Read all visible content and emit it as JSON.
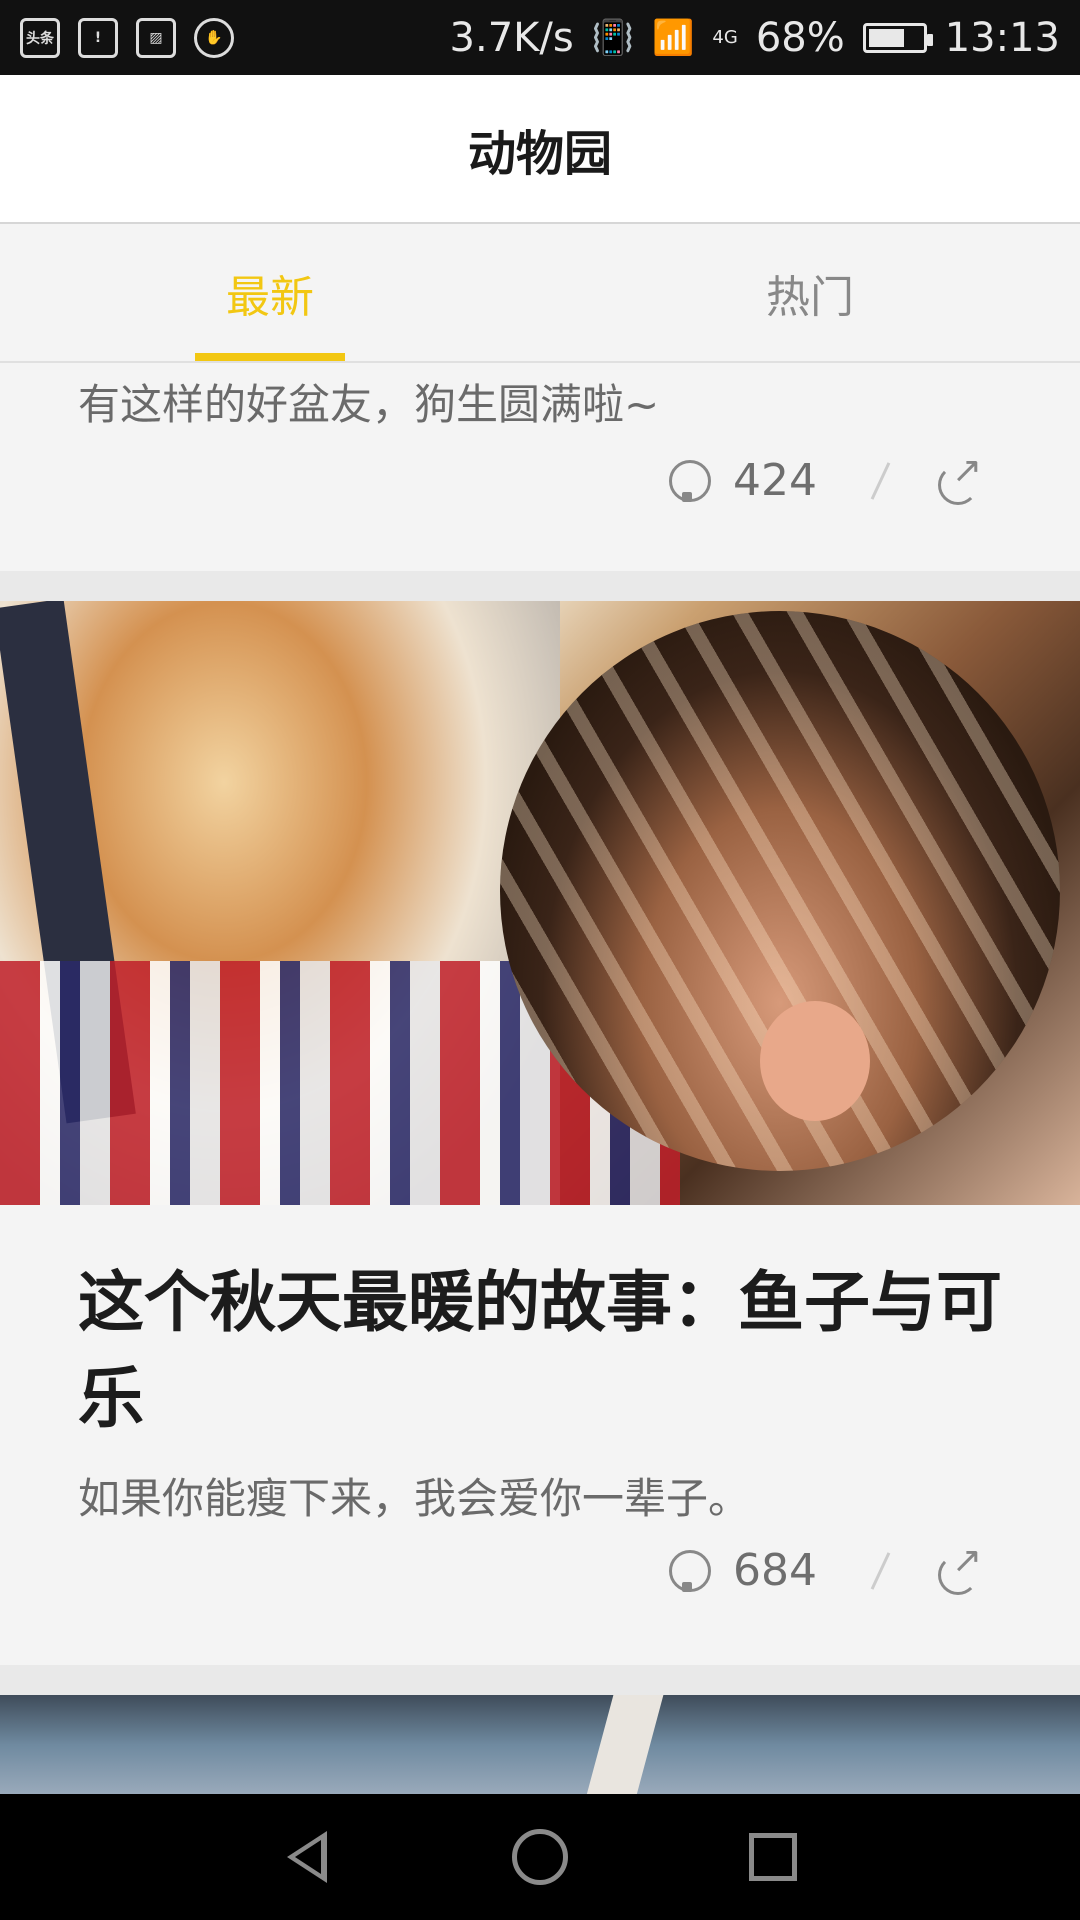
{
  "status_bar": {
    "app_badge": "头条",
    "speed": "3.7K/s",
    "network": "4G",
    "battery_percent": "68%",
    "battery_level": 0.68,
    "time": "13:13"
  },
  "header": {
    "title": "动物园"
  },
  "tabs": [
    {
      "label": "最新",
      "active": true
    },
    {
      "label": "热门",
      "active": false
    }
  ],
  "feed": {
    "cards": [
      {
        "subtitle": "有这样的好盆友，狗生圆满啦~",
        "comment_count": "424"
      },
      {
        "title": "这个秋天最暖的故事：鱼子与可乐",
        "subtitle": "如果你能瘦下来，我会爱你一辈子。",
        "comment_count": "684"
      }
    ]
  },
  "colors": {
    "accent": "#f2c712",
    "background": "#f4f4f4"
  },
  "icons": [
    "comment-bulb-icon",
    "share-icon",
    "back-icon",
    "home-icon",
    "recent-apps-icon"
  ]
}
